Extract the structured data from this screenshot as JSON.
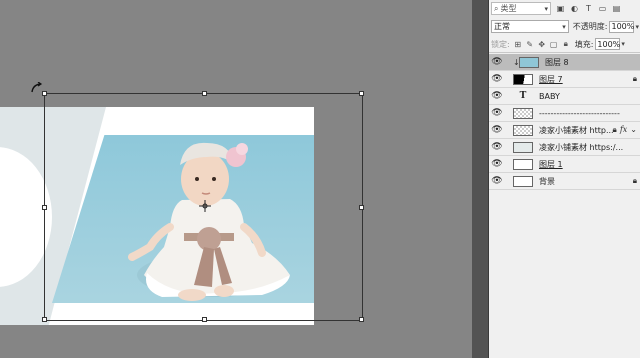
{
  "layers_panel": {
    "search_placeholder": "类型",
    "filter_icons": [
      "image-filter-icon",
      "adjustment-filter-icon",
      "type-filter-icon",
      "shape-filter-icon",
      "smart-object-filter-icon"
    ],
    "blend_mode": "正常",
    "opacity_label": "不透明度:",
    "opacity_value": "100%",
    "lock_label": "锁定:",
    "fill_label": "填充:",
    "fill_value": "100%",
    "layers": [
      {
        "name": "图层 8",
        "selected": true,
        "clipped": true,
        "thumb": "photo"
      },
      {
        "name": "图层 7",
        "locked": true,
        "thumb": "shape"
      },
      {
        "name": "BABY",
        "type": "text"
      },
      {
        "name": "----------------------------",
        "thumb": "checker"
      },
      {
        "name": "凌家小铺素材 http...",
        "locked": true,
        "fx": "fx",
        "thumb": "checker"
      },
      {
        "name": "凌家小铺素材 https:/...",
        "thumb": "grey"
      },
      {
        "name": "图层 1",
        "thumb": "white"
      },
      {
        "name": "背景",
        "locked": true,
        "thumb": "white"
      }
    ]
  },
  "colors": {
    "canvas_bg": "#858585",
    "panel_bg": "#f0f0f0",
    "doc_bg": "#ffffff",
    "left_panel": "#dfe6e8",
    "photo_bg": "#8fc6d6",
    "selected_row": "#bcbcbc"
  }
}
